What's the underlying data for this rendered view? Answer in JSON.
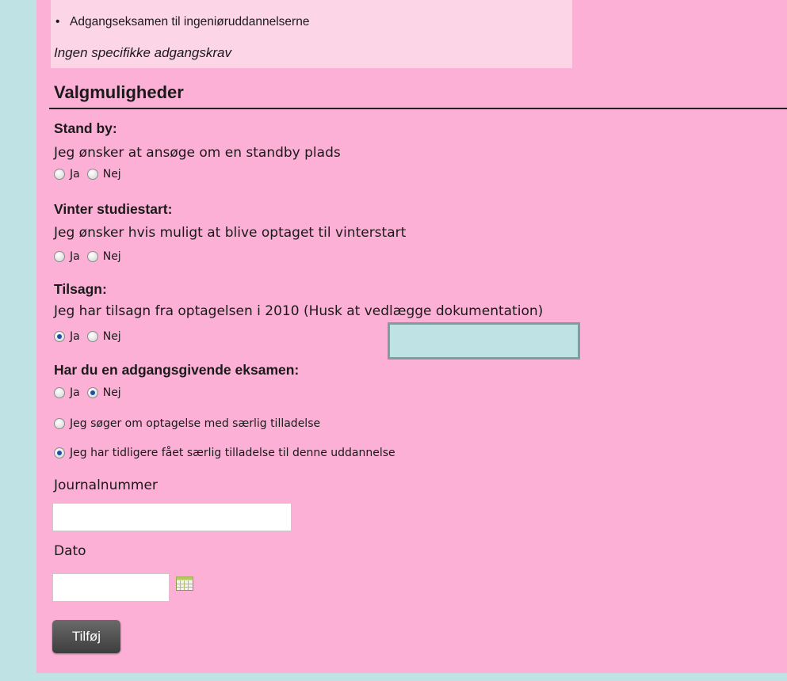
{
  "requirements": {
    "bullet_item": "Adgangseksamen til ingeniøruddannelserne",
    "note": "Ingen specifikke adgangskrav"
  },
  "section_title": "Valgmuligheder",
  "questions": [
    {
      "label": "Stand by:",
      "description": "Jeg ønsker at ansøge om en standby plads",
      "options": [
        {
          "label": "Ja",
          "checked": false
        },
        {
          "label": "Nej",
          "checked": false
        }
      ]
    },
    {
      "label": "Vinter studiestart:",
      "description": "Jeg ønsker hvis muligt at blive optaget til vinterstart",
      "options": [
        {
          "label": "Ja",
          "checked": false
        },
        {
          "label": "Nej",
          "checked": false
        }
      ]
    },
    {
      "label": "Tilsagn:",
      "description": "Jeg har tilsagn fra optagelsen i 2010 (Husk at vedlægge dokumentation)",
      "options": [
        {
          "label": "Ja",
          "checked": true
        },
        {
          "label": "Nej",
          "checked": false
        }
      ]
    },
    {
      "label": "Har du en adgangsgivende eksamen:",
      "options": [
        {
          "label": "Ja",
          "checked": false
        },
        {
          "label": "Nej",
          "checked": true
        }
      ],
      "extra_options": [
        {
          "label": "Jeg søger om optagelse med særlig tilladelse",
          "checked": false
        },
        {
          "label": "Jeg har tidligere fået særlig tilladelse til denne uddannelse",
          "checked": true
        }
      ]
    }
  ],
  "fields": {
    "journal_label": "Journalnummer",
    "journal_value": "",
    "date_label": "Dato",
    "date_value": ""
  },
  "add_button": "Tilføj",
  "colors": {
    "panel": "#fcb0d6",
    "requirement_box": "#fcd6e6",
    "background": "#bfe3e4",
    "radio_selected": "#1f4fa0"
  },
  "icons": {
    "calendar": "calendar-icon",
    "radio": "radio-icon"
  }
}
